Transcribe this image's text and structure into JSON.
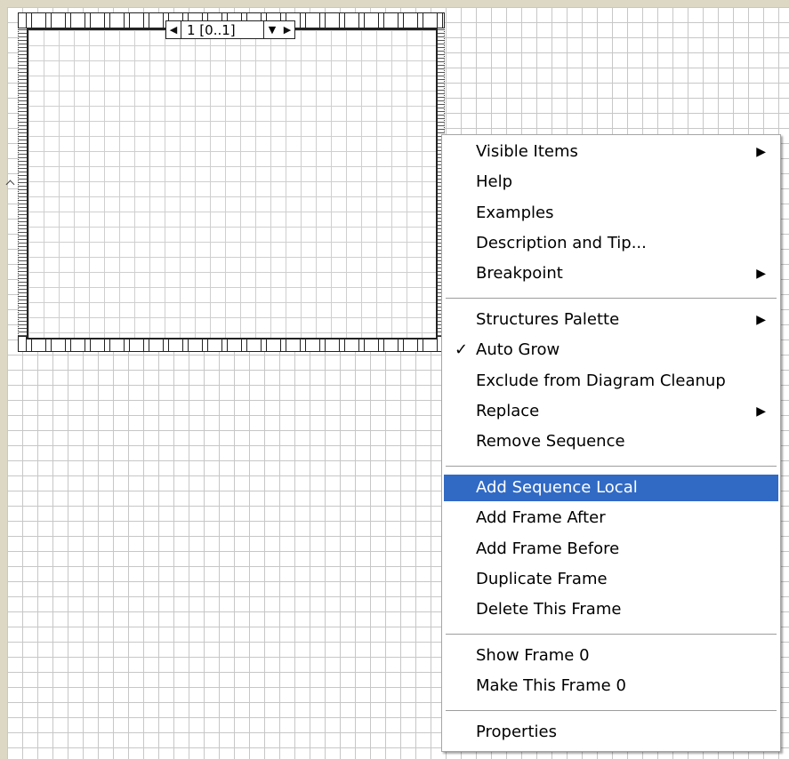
{
  "sequence": {
    "frame_selector_label": "1 [0..1]"
  },
  "context_menu": {
    "groups": [
      [
        {
          "label": "Visible Items",
          "submenu": true
        },
        {
          "label": "Help"
        },
        {
          "label": "Examples"
        },
        {
          "label": "Description and Tip..."
        },
        {
          "label": "Breakpoint",
          "submenu": true
        }
      ],
      [
        {
          "label": "Structures Palette",
          "submenu": true
        },
        {
          "label": "Auto Grow",
          "checked": true
        },
        {
          "label": "Exclude from Diagram Cleanup"
        },
        {
          "label": "Replace",
          "submenu": true
        },
        {
          "label": "Remove Sequence"
        }
      ],
      [
        {
          "label": "Add Sequence Local",
          "highlighted": true
        },
        {
          "label": "Add Frame After"
        },
        {
          "label": "Add Frame Before"
        },
        {
          "label": "Duplicate Frame"
        },
        {
          "label": "Delete This Frame"
        }
      ],
      [
        {
          "label": "Show Frame 0"
        },
        {
          "label": "Make This Frame 0"
        }
      ],
      [
        {
          "label": "Properties"
        }
      ]
    ],
    "highlight_color": "#316ac5"
  }
}
